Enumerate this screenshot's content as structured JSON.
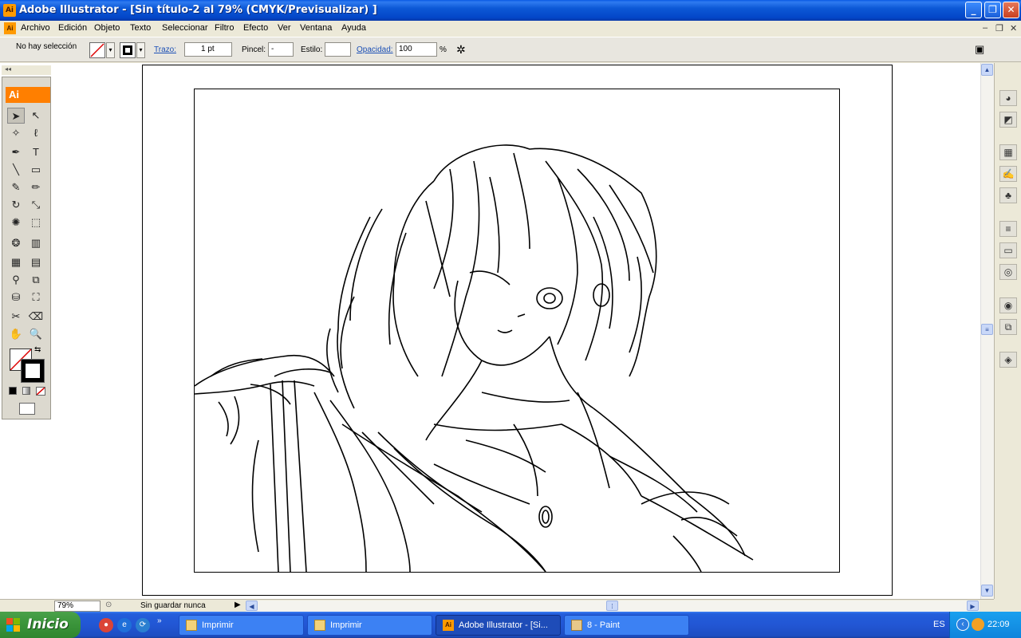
{
  "window": {
    "title": "Adobe Illustrator - [Sin título-2 al 79% (CMYK/Previsualizar) ]",
    "app_icon": "Ai"
  },
  "menu": [
    "Archivo",
    "Edición",
    "Objeto",
    "Texto",
    "Seleccionar",
    "Filtro",
    "Efecto",
    "Ver",
    "Ventana",
    "Ayuda"
  ],
  "control": {
    "selection": "No hay selección",
    "stroke_label": "Trazo:",
    "stroke_value": "1 pt",
    "brush_label": "Pincel:",
    "brush_value": "-",
    "style_label": "Estilo:",
    "opacity_label": "Opacidad:",
    "opacity_value": "100",
    "opacity_unit": "%"
  },
  "tools": {
    "logo": "Ai"
  },
  "status": {
    "zoom": "79%",
    "save_state": "Sin guardar nunca"
  },
  "taskbar": {
    "start": "Inicio",
    "tasks": [
      "Imprimir",
      "Imprimir",
      "Adobe Illustrator - [Si...",
      "8 - Paint"
    ],
    "lang": "ES",
    "time": "22:09"
  },
  "colors": {
    "title_blue": "#0346c8",
    "ai_orange": "#ff7f00",
    "start_green": "#3c963c"
  }
}
